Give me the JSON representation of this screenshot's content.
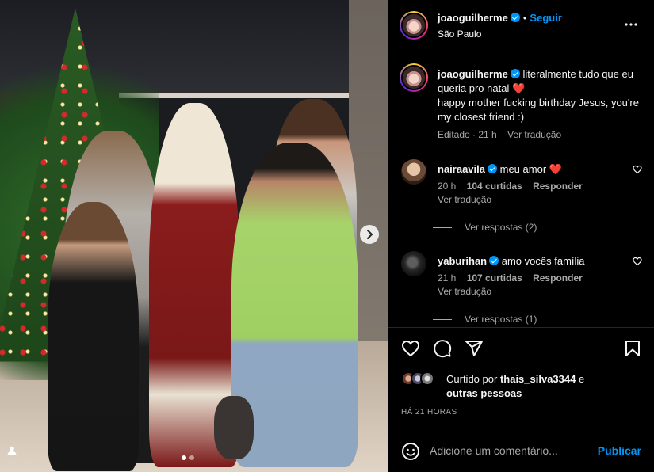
{
  "post": {
    "location": "São Paulo",
    "author": {
      "username": "joaoguilherme",
      "verified": true,
      "follow_label": "Seguir"
    },
    "carousel": {
      "slide_count": 2,
      "active_index": 0
    },
    "caption": {
      "username": "joaoguilherme",
      "line1": "literalmente tudo que eu queria pro natal",
      "line2": "happy mother fucking birthday Jesus, you're my closest friend :)",
      "heart": "❤️",
      "edited_label": "Editado",
      "age": "21 h",
      "translate_label": "Ver tradução"
    },
    "comments": [
      {
        "username": "nairaavila",
        "text": "meu amor",
        "heart": "❤️",
        "age": "20 h",
        "likes": "104 curtidas",
        "reply_label": "Responder",
        "translate_label": "Ver tradução",
        "view_replies": "Ver respostas (2)"
      },
      {
        "username": "yaburihan",
        "text": "amo vocês família",
        "age": "21 h",
        "likes": "107 curtidas",
        "reply_label": "Responder",
        "translate_label": "Ver tradução",
        "view_replies": "Ver respostas (1)"
      }
    ],
    "likes": {
      "prefix": "Curtido por",
      "user": "thais_silva3344",
      "conj": "e",
      "others": "outras pessoas"
    },
    "timestamp": "HÁ 21 HORAS",
    "add_comment": {
      "placeholder": "Adicione um comentário...",
      "publish_label": "Publicar"
    }
  },
  "icons": [
    "heart-icon",
    "comment-icon",
    "share-icon",
    "bookmark-icon",
    "emoji-icon",
    "more-icon",
    "chevron-right-icon",
    "user-tag-icon"
  ],
  "colors": {
    "accent": "#0095f6",
    "like_red": "#ff3040",
    "background": "#000000",
    "secondary_text": "#a8a8a8"
  }
}
